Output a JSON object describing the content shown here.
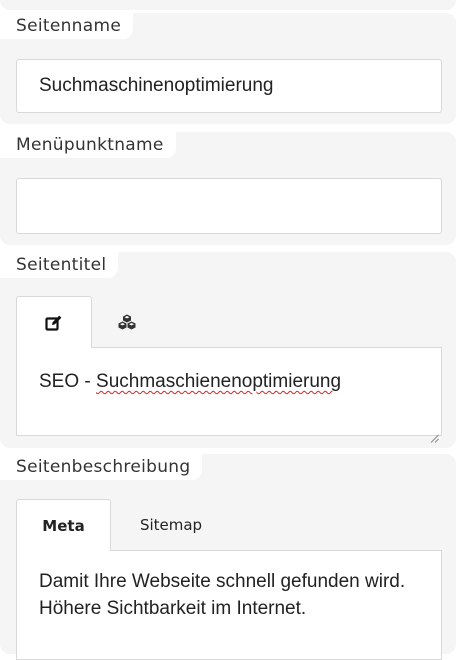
{
  "fields": {
    "page_name": {
      "label": "Seitenname",
      "value": "Suchmaschinenoptimierung"
    },
    "menu_item_name": {
      "label": "Menüpunktname",
      "value": ""
    },
    "page_title": {
      "label": "Seitentitel",
      "tabs": [
        {
          "icon": "edit-icon",
          "active": true
        },
        {
          "icon": "cubes-icon",
          "active": false
        }
      ],
      "value_prefix": "SEO - ",
      "value_misspelled": "Suchmaschienenoptimierung"
    },
    "page_description": {
      "label": "Seitenbeschreibung",
      "tabs": [
        {
          "label": "Meta",
          "active": true
        },
        {
          "label": "Sitemap",
          "active": false
        }
      ],
      "value": "Damit Ihre Webseite schnell gefunden wird. Höhere Sichtbarkeit im Internet."
    }
  },
  "colors": {
    "panel_background": "#f5f5f5",
    "field_border": "#d9d9d9",
    "spellcheck_underline": "#e02020"
  }
}
